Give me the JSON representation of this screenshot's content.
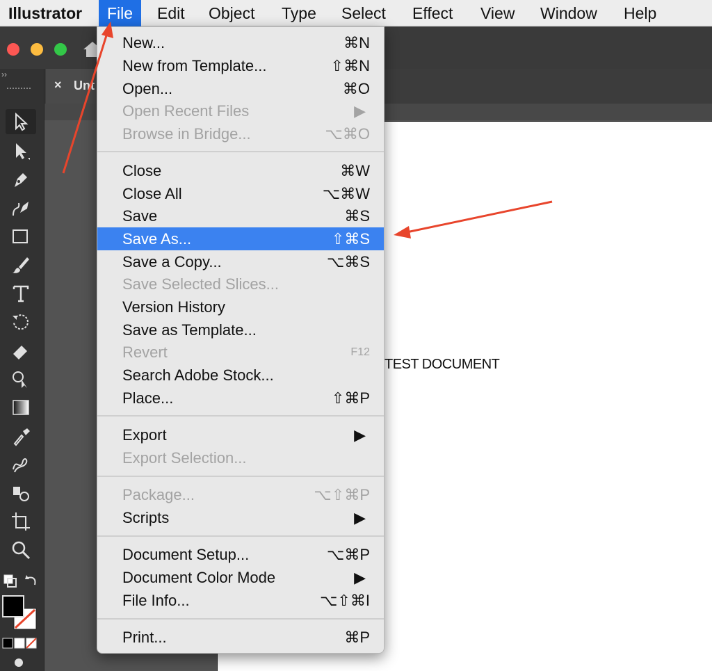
{
  "menubar": {
    "app_name": "Illustrator",
    "items": [
      "File",
      "Edit",
      "Object",
      "Type",
      "Select",
      "Effect",
      "View",
      "Window",
      "Help"
    ]
  },
  "window": {
    "traffic_lights": {
      "close": "#fc5753",
      "minimize": "#fdbc40",
      "maximize": "#33c748"
    },
    "collapse_glyph": "››"
  },
  "document_tab": {
    "close_glyph": "×",
    "title": "Unt"
  },
  "artboard": {
    "text": "TEST DOCUMENT"
  },
  "file_menu": {
    "items": [
      {
        "label": "New...",
        "shortcut": "⌘N"
      },
      {
        "label": "New from Template...",
        "shortcut": "⇧⌘N"
      },
      {
        "label": "Open...",
        "shortcut": "⌘O"
      },
      {
        "label": "Open Recent Files",
        "shortcut": "▶"
      },
      {
        "label": "Browse in Bridge...",
        "shortcut": "⌥⌘O"
      },
      {
        "label": "Close",
        "shortcut": "⌘W"
      },
      {
        "label": "Close All",
        "shortcut": "⌥⌘W"
      },
      {
        "label": "Save",
        "shortcut": "⌘S"
      },
      {
        "label": "Save As...",
        "shortcut": "⇧⌘S"
      },
      {
        "label": "Save a Copy...",
        "shortcut": "⌥⌘S"
      },
      {
        "label": "Save Selected Slices...",
        "shortcut": ""
      },
      {
        "label": "Version History",
        "shortcut": ""
      },
      {
        "label": "Save as Template...",
        "shortcut": ""
      },
      {
        "label": "Revert",
        "shortcut": "F12"
      },
      {
        "label": "Search Adobe Stock...",
        "shortcut": ""
      },
      {
        "label": "Place...",
        "shortcut": "⇧⌘P"
      },
      {
        "label": "Export",
        "shortcut": "▶"
      },
      {
        "label": "Export Selection...",
        "shortcut": ""
      },
      {
        "label": "Package...",
        "shortcut": "⌥⇧⌘P"
      },
      {
        "label": "Scripts",
        "shortcut": "▶"
      },
      {
        "label": "Document Setup...",
        "shortcut": "⌥⌘P"
      },
      {
        "label": "Document Color Mode",
        "shortcut": "▶"
      },
      {
        "label": "File Info...",
        "shortcut": "⌥⇧⌘I"
      },
      {
        "label": "Print...",
        "shortcut": "⌘P"
      }
    ]
  },
  "colors": {
    "menu_highlight": "#3b82f0",
    "annotation_arrow": "#e8452c"
  }
}
